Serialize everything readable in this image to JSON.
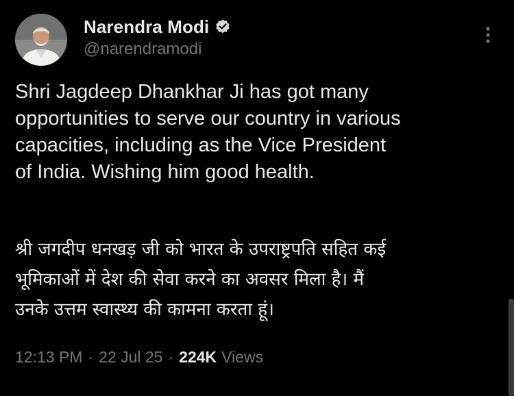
{
  "author": {
    "display_name": "Narendra Modi",
    "handle": "@narendramodi",
    "verified_icon": "verified-badge-icon",
    "verified_color": "#1d9bf0"
  },
  "tweet": {
    "text_english": "Shri Jagdeep Dhankhar Ji has got many\nopportunities to serve our country in various\ncapacities, including as the Vice President\nof India. Wishing him good health.",
    "text_hindi": "श्री जगदीप धनखड़ जी को भारत के उपराष्ट्रपति सहित कई\nभूमिकाओं में देश की सेवा करने का अवसर मिला है। मैं\nउनके उत्तम स्वास्थ्य की कामना करता हूं।"
  },
  "meta": {
    "time": "12:13 PM",
    "separator": "·",
    "date": "22 Jul 25",
    "views_count": "224K",
    "views_label": "Views"
  },
  "icons": {
    "more": "more-options-icon",
    "avatar": "avatar"
  },
  "colors": {
    "background": "#000000",
    "text_primary": "#e7e9ea",
    "text_secondary": "#71767b"
  }
}
